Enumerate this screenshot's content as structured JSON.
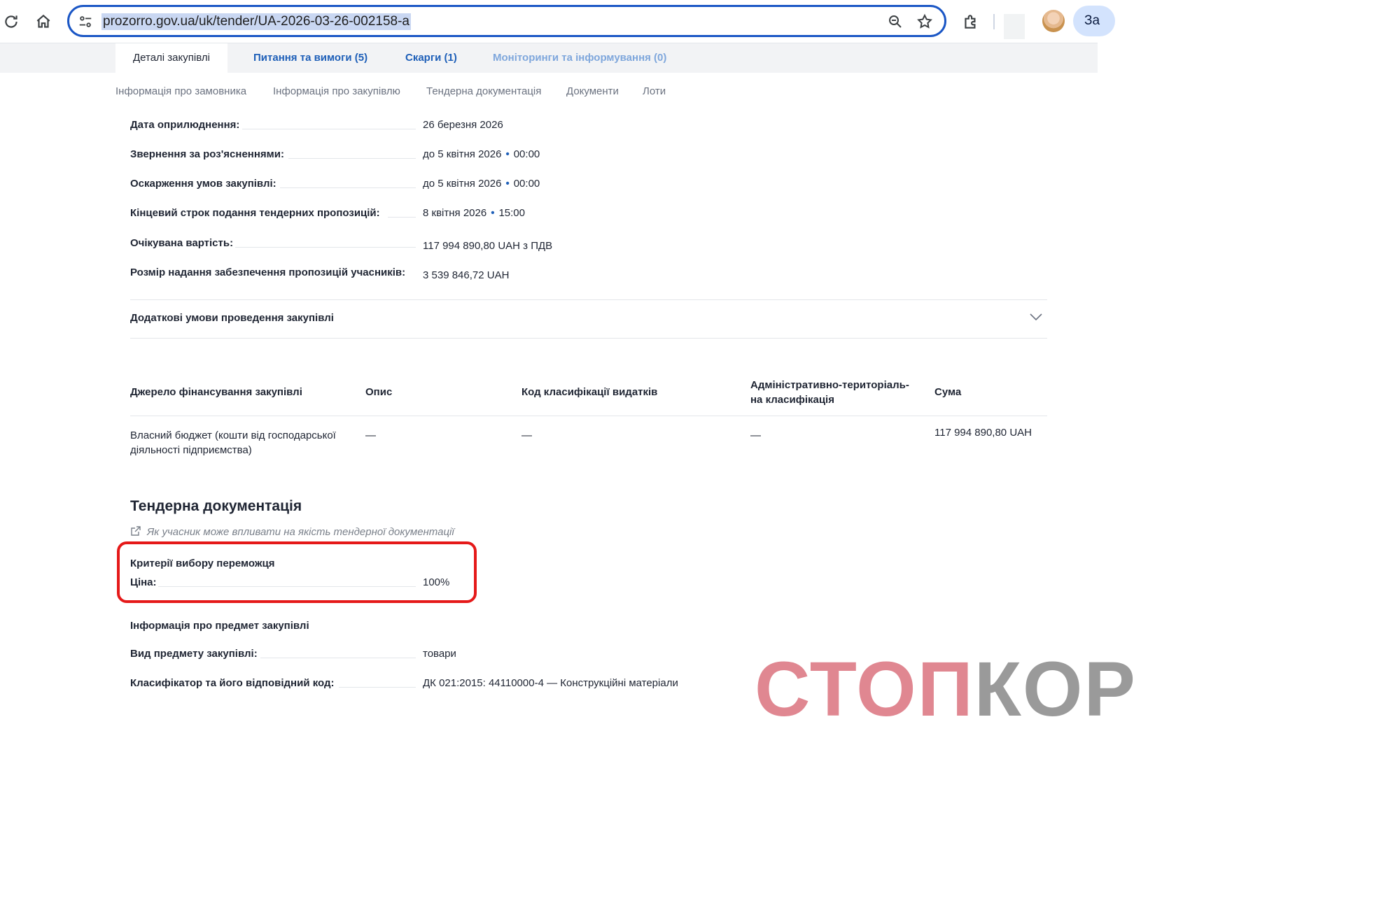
{
  "browser": {
    "url": "prozorro.gov.ua/uk/tender/UA-2026-03-26-002158-a",
    "profile_button": "За"
  },
  "tabs": [
    {
      "label": "Деталі закупівлі"
    },
    {
      "label": "Питання та вимоги (5)"
    },
    {
      "label": "Скарги (1)"
    },
    {
      "label": "Моніторинги та інформування (0)"
    }
  ],
  "subnav": [
    "Інформація про замовника",
    "Інформація про закупівлю",
    "Тендерна документація",
    "Документи",
    "Лоти"
  ],
  "details": [
    {
      "label": "Дата оприлюднення:",
      "value": "26 березня 2026"
    },
    {
      "label": "Звернення за роз'ясненнями:",
      "date": "до 5 квітня 2026",
      "time": "00:00"
    },
    {
      "label": "Оскарження умов закупівлі:",
      "date": "до 5 квітня 2026",
      "time": "00:00"
    },
    {
      "label": "Кінцевий строк подання тендерних пропозицій:",
      "date": "8 квітня 2026",
      "time": "15:00"
    },
    {
      "label": "Очікувана вартість:",
      "value": "117 994 890,80 UAH з ПДВ"
    },
    {
      "label": "Розмір надання забезпечення пропозицій учасників:",
      "value": "3 539 846,72 UAH"
    }
  ],
  "additional_conditions": "Додаткові умови проведення закупівлі",
  "funding": {
    "headers": [
      "Джерело фінансування закупівлі",
      "Опис",
      "Код класифікації видатків",
      "Адміністративно-територіаль-",
      "на класифікація",
      "Сума"
    ],
    "row": {
      "source_line1": "Власний бюджет (кошти від господарської",
      "source_line2": "діяльності підприємства)",
      "description": "—",
      "expense_code": "—",
      "admin_class": "—",
      "amount": "117 994 890,80 UAH"
    }
  },
  "tender_docs": {
    "title": "Тендерна документація",
    "help_link": "Як учасник може впливати на якість тендерної документації"
  },
  "criteria": {
    "title": "Критерії вибору переможця",
    "price_label": "Ціна:",
    "price_value": "100%"
  },
  "subject": {
    "title": "Інформація про предмет закупівлі",
    "type_label": "Вид предмету закупівлі:",
    "type_value": "товари",
    "classifier_label": "Класифікатор та його відповідний код:",
    "classifier_value": "ДК 021:2015: 44110000-4 — Конструкційні матеріали"
  },
  "watermark": {
    "part1": "СТОП",
    "part2": "КОР"
  }
}
